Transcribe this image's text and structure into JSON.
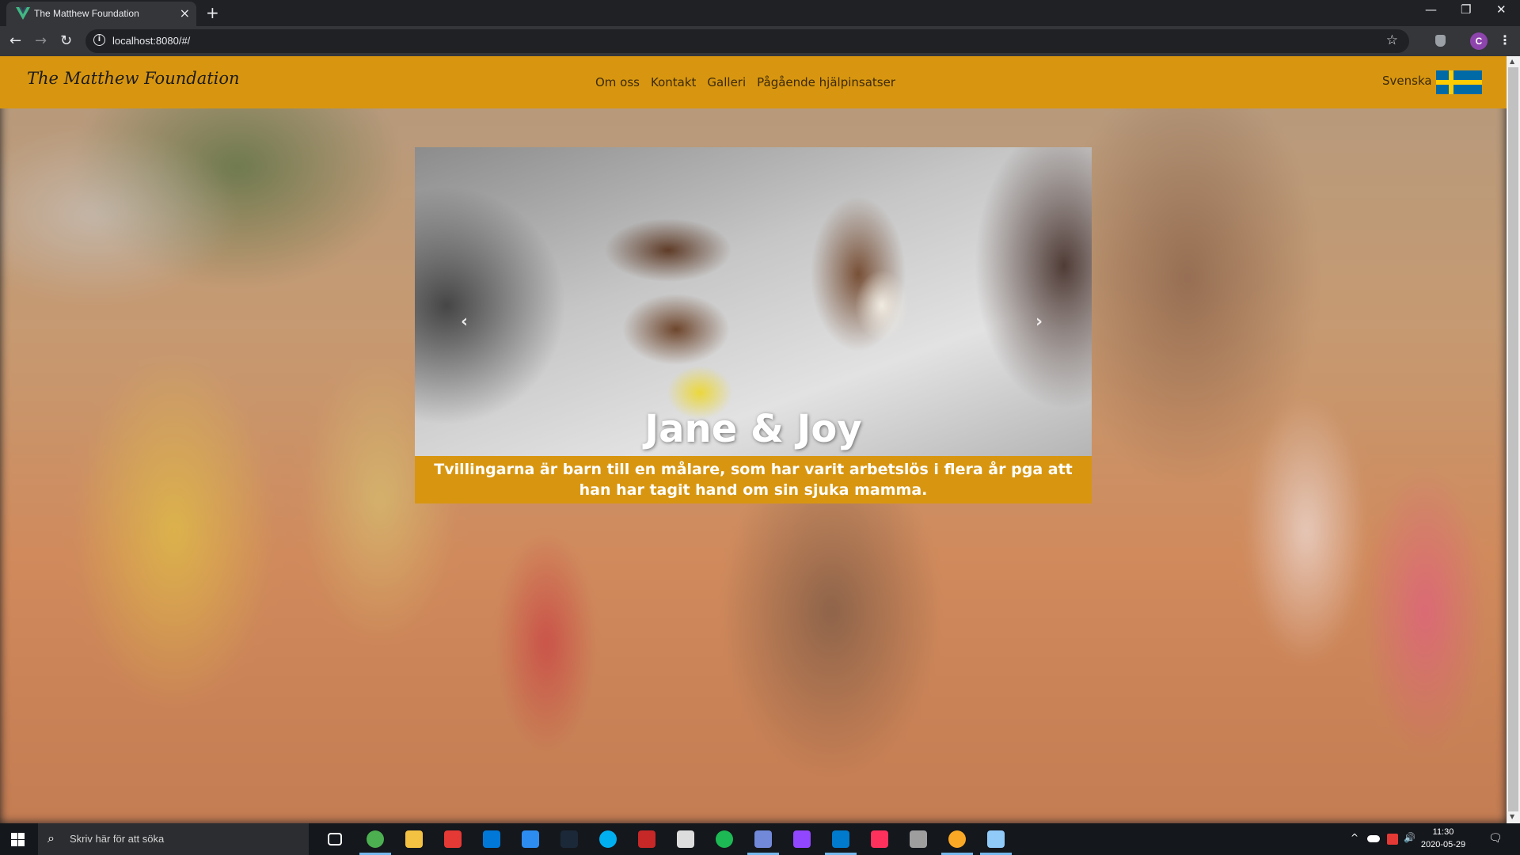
{
  "browser": {
    "tab_title": "The Matthew Foundation",
    "tab_close": "×",
    "new_tab": "+",
    "url": "localhost:8080/#/",
    "info_glyph": "i",
    "profile_initial": "C",
    "icons": {
      "back": "←",
      "forward": "→",
      "reload": "↻",
      "star": "☆",
      "menu": "⋮",
      "minimize": "—",
      "restore": "❐",
      "close": "✕"
    }
  },
  "site": {
    "brand": "The Matthew Foundation",
    "nav": [
      "Om oss",
      "Kontakt",
      "Galleri",
      "Pågående hjälpinsatser"
    ],
    "language": "Svenska",
    "flag_colors": {
      "blue": "#006aa7",
      "yellow": "#fecc00"
    },
    "accent_color": "#d89610"
  },
  "carousel": {
    "prev": "‹",
    "next": "›",
    "title": "Jane & Joy",
    "caption": "Tvillingarna är barn till en målare, som har varit arbetslös i flera år pga att han har tagit hand om sin sjuka mamma."
  },
  "taskbar": {
    "search_placeholder": "Skriv här för att söka",
    "search_icon": "⌕",
    "apps": [
      {
        "name": "task-view-icon",
        "color": "#ffffff"
      },
      {
        "name": "chrome-icon",
        "color": "#4caf50"
      },
      {
        "name": "file-explorer-icon",
        "color": "#f4c242"
      },
      {
        "name": "gift-icon",
        "color": "#e53935"
      },
      {
        "name": "store-icon",
        "color": "#0078d7"
      },
      {
        "name": "mail-icon",
        "color": "#2d8cf0"
      },
      {
        "name": "steam-icon",
        "color": "#1b2838"
      },
      {
        "name": "skype-icon",
        "color": "#00aff0"
      },
      {
        "name": "settings-app-icon",
        "color": "#c62828"
      },
      {
        "name": "speedometer-icon",
        "color": "#dddddd"
      },
      {
        "name": "spotify-icon",
        "color": "#1db954"
      },
      {
        "name": "discord-icon",
        "color": "#7289da"
      },
      {
        "name": "twitch-icon",
        "color": "#9146ff"
      },
      {
        "name": "vscode-icon",
        "color": "#007acc"
      },
      {
        "name": "intellij-icon",
        "color": "#fe315d"
      },
      {
        "name": "cloud-app-icon",
        "color": "#9e9e9e"
      },
      {
        "name": "chrome-dev-icon",
        "color": "#f9a825"
      },
      {
        "name": "paint-icon",
        "color": "#90caf9"
      }
    ],
    "tray": {
      "chevron": "^",
      "volume": "🔊"
    },
    "time": "11:30",
    "date": "2020-05-29"
  }
}
